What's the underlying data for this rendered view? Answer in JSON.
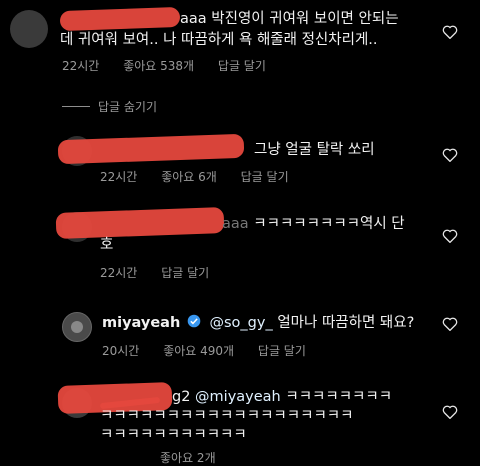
{
  "comments": [
    {
      "prefix": "aaa",
      "text_line1": "박진영이 귀여워 보이면 안되는",
      "text_line2": "데 귀여워 보여.. 나 따끔하게 욕 해줄래 정신차리게..",
      "time": "22시간",
      "likes": "좋아요 538개",
      "reply": "답글 달기"
    },
    {
      "text_line1": "그냥 얼굴 탈락 쏘리",
      "time": "22시간",
      "likes": "좋아요 6개",
      "reply": "답글 달기"
    },
    {
      "prefix": "aaa",
      "text_line1": "ㅋㅋㅋㅋㅋㅋㅋㅋ역시 단",
      "text_line2": "호",
      "time": "22시간",
      "reply": "답글 달기"
    },
    {
      "username": "miyayeah",
      "mention": "@so_gy_",
      "text_line1": "얼마나 따끔하면 돼요?",
      "time": "20시간",
      "likes": "좋아요 490개",
      "reply": "답글 달기"
    },
    {
      "prefix": "g2",
      "mention": "@miyayeah",
      "text_line1": "ㅋㅋㅋㅋㅋㅋㅋㅋ",
      "text_line2": "ㅋㅋㅋㅋㅋㅋㅋㅋㅋㅋㅋㅋㅋㅋㅋㅋㅋㅋㅋ",
      "text_line3": "ㅋㅋㅋㅋㅋㅋㅋㅋㅋㅋㅋ",
      "likes": "좋아요 2개"
    }
  ],
  "hide_replies": "답글 숨기기",
  "colors": {
    "background": "#000000",
    "redaction": "#e5483d",
    "verified": "#3897f0",
    "meta": "#9a9a9a"
  }
}
